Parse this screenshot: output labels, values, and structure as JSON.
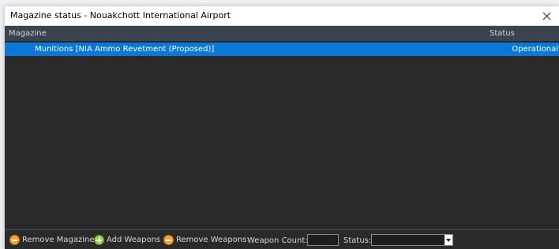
{
  "window": {
    "title": "Magazine status - Nouakchott International Airport"
  },
  "table": {
    "columns": [
      "Magazine",
      "Status"
    ],
    "rows": [
      {
        "magazine": "Munitions [NIA Ammo Revetment (Proposed)]",
        "status": "Operational"
      }
    ],
    "selected_row_color": "#0a78d7"
  },
  "toolbar": {
    "remove_magazine_label": "Remove Magazine",
    "add_weapons_label": "Add Weapons",
    "remove_weapons_label": "Remove Weapons",
    "weapon_count_label": "Weapon Count:",
    "weapon_count_value": "",
    "status_label": "Status:",
    "status_value": ""
  },
  "colors": {
    "background": "#2a2a2a",
    "header": "#3c4350",
    "accent": "#0a78d7",
    "remove_icon": "#f0a235",
    "add_icon": "#8fd13a"
  },
  "icons": {
    "close": "close-icon",
    "remove": "minus-circle-icon",
    "add": "plus-circle-icon",
    "dropdown": "chevron-down-icon"
  }
}
